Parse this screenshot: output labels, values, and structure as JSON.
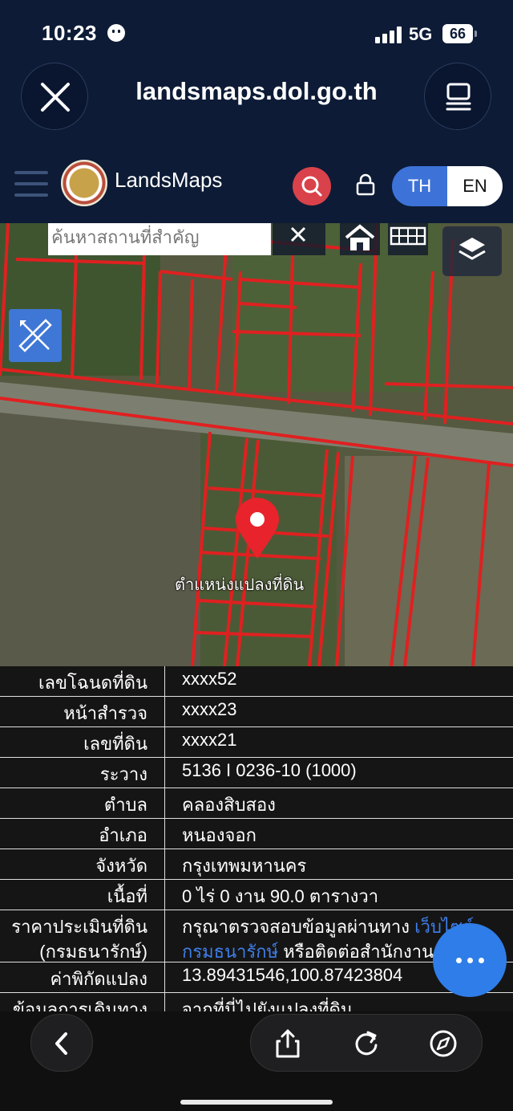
{
  "status_bar": {
    "time": "10:23",
    "network": "5G",
    "battery": "66"
  },
  "browser": {
    "url": "landsmaps.dol.go.th"
  },
  "app": {
    "brand": "LandsMaps",
    "lang_th": "TH",
    "lang_en": "EN"
  },
  "map": {
    "search_placeholder": "ค้นหาสถานที่สำคัญ",
    "pin_label": "ตำแหน่งแปลงที่ดิน"
  },
  "info": {
    "rows": [
      {
        "key": "เลขโฉนดที่ดิน",
        "value": "xxxx52"
      },
      {
        "key": "หน้าสำรวจ",
        "value": "xxxx23"
      },
      {
        "key": "เลขที่ดิน",
        "value": "xxxx21"
      },
      {
        "key": "ระวาง",
        "value": "5136 I 0236-10 (1000)"
      },
      {
        "key": "ตำบล",
        "value": "คลองสิบสอง"
      },
      {
        "key": "อำเภอ",
        "value": "หนองจอก"
      },
      {
        "key": "จังหวัด",
        "value": "กรุงเทพมหานคร"
      },
      {
        "key": "เนื้อที่",
        "value": "0 ไร่ 0 งาน 90.0 ตารางวา"
      }
    ],
    "price_key_1": "ราคาประเมินที่ดิน",
    "price_key_2": "(กรมธนารักษ์)",
    "price_text_1": "กรุณาตรวจสอบข้อมูลผ่านทาง ",
    "price_link_1": "เว็บไซต์",
    "price_link_2": "กรมธนารักษ์",
    "price_text_2": " หรือติดต่อสำนักงาน",
    "coord_key": "ค่าพิกัดแปลง",
    "coord_value": "13.89431546,100.87423804",
    "route_key": "ข้อมูลการเดินทาง",
    "route_value": "จากที่นี่ไปยังแปลงที่ดิน"
  },
  "icons": {
    "close": "close-icon",
    "reader": "reader-icon",
    "menu": "hamburger-icon",
    "search": "search-icon",
    "lock": "lock-icon",
    "home": "home-icon",
    "grid": "grid-icon",
    "layers": "layers-icon",
    "measure": "ruler-pencil-icon",
    "more": "more-icon",
    "back": "chevron-left-icon",
    "share": "share-icon",
    "reload": "reload-icon",
    "compass": "compass-icon"
  },
  "colors": {
    "accent": "#3d73d8",
    "danger": "#d9424a",
    "parcel_line": "#e02020",
    "link": "#3f7ee8"
  }
}
